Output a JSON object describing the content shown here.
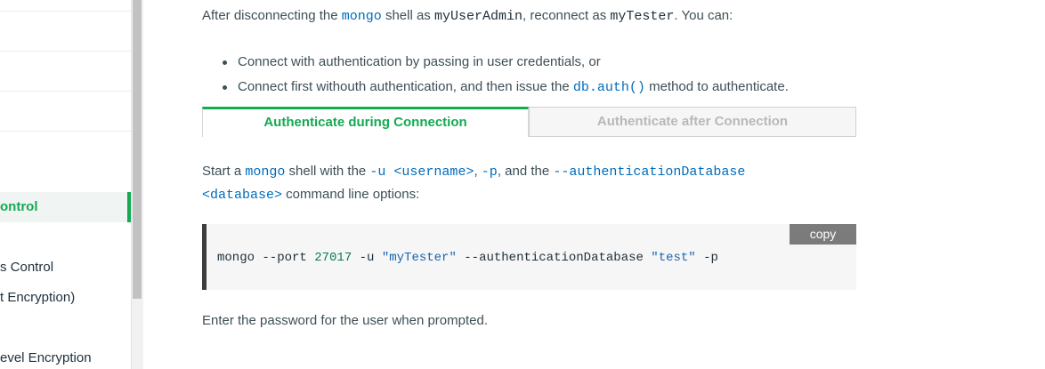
{
  "sidebar": {
    "items": [
      {
        "label": "ontrol",
        "active": true
      },
      {
        "label": "s Control"
      },
      {
        "label": "t Encryption)"
      },
      {
        "label": "evel Encryption"
      }
    ]
  },
  "intro": {
    "t1": "After disconnecting the ",
    "c1": "mongo",
    "t2": " shell as ",
    "c2": "myUserAdmin",
    "t3": ", reconnect as ",
    "c3": "myTester",
    "t4": ". You can:"
  },
  "bullets": {
    "b1": "Connect with authentication by passing in user credentials, or",
    "b2_pre": "Connect first withouth authentication, and then issue the ",
    "b2_code": "db.auth()",
    "b2_post": " method to authenticate."
  },
  "tabs": {
    "active": "Authenticate during Connection",
    "inactive": "Authenticate after Connection"
  },
  "start": {
    "t1": "Start a ",
    "c1": "mongo",
    "t2": " shell with the ",
    "c2": "-u <username>",
    "t3": ", ",
    "c3": "-p",
    "t4": ", and the ",
    "c4": "--authenticationDatabase",
    "c5": "<database>",
    "t5": " command line options:"
  },
  "code": {
    "copy_label": "copy",
    "part1": "mongo --port ",
    "port": "27017",
    "part2": " -u ",
    "user": "\"myTester\"",
    "part3": " --authenticationDatabase ",
    "db": "\"test\"",
    "part4": " -p"
  },
  "footer": {
    "text": "Enter the password for the user when prompted."
  },
  "colors": {
    "accent": "#13aa52",
    "code_blue": "#006cbc"
  }
}
